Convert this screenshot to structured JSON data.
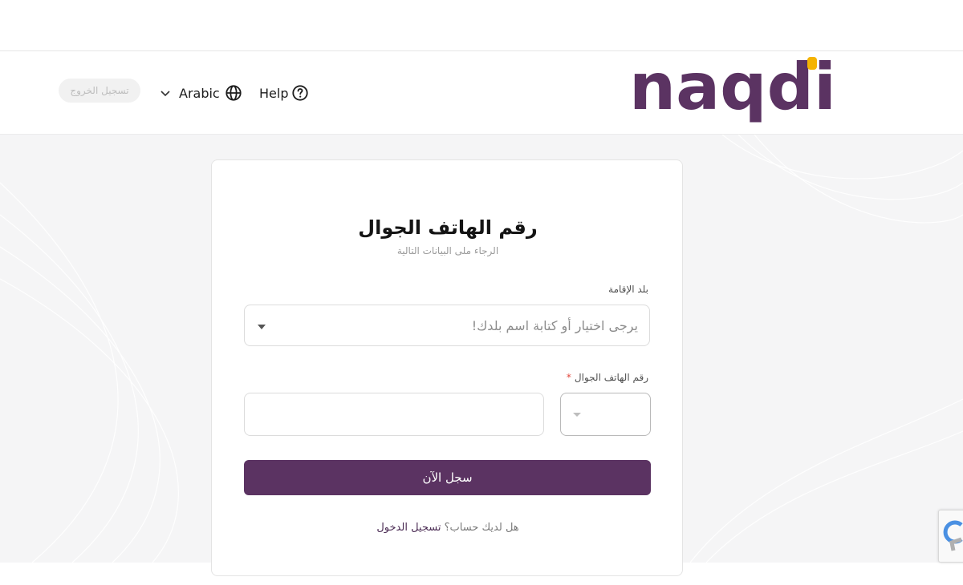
{
  "header": {
    "logout_label": "تسجيل الخروج",
    "language_label": "Arabic",
    "help_label": "Help",
    "logo_text": "naqdi"
  },
  "form": {
    "title": "رقم الهاتف الجوال",
    "subtitle": "الرجاء ملى البيانات التالية",
    "country_label": "بلد الإقامة",
    "country_placeholder": "يرجى اختيار أو كتابة اسم بلدك!",
    "phone_label": "رقم الهاتف الجوال",
    "required_mark": "*",
    "phone_value": "",
    "country_code_value": "",
    "submit_label": "سجل الآن",
    "have_account_text": "هل لديك حساب؟",
    "signin_link": "تسجيل الدخول"
  },
  "colors": {
    "brand_purple": "#5b3362",
    "logo_accent": "#f5b301",
    "required": "#e2453b"
  },
  "icons": {
    "language": "globe-icon",
    "language_dropdown": "chevron-down-icon",
    "help": "question-circle-icon",
    "select_caret": "caret-down-icon",
    "recaptcha": "recaptcha-icon"
  }
}
